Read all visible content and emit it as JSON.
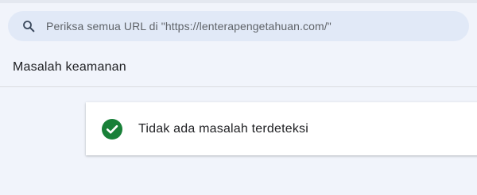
{
  "search": {
    "placeholder": "Periksa semua URL di \"https://lenterapengetahuan.com/\"",
    "icon": "search-icon"
  },
  "section": {
    "title": "Masalah keamanan"
  },
  "result": {
    "status_text": "Tidak ada masalah terdeteksi",
    "icon": "check-circle-icon",
    "status_color": "#188038"
  },
  "colors": {
    "background": "#f1f4fb",
    "search_bg": "#e1e9f7",
    "card_bg": "#ffffff",
    "text": "#202124"
  }
}
